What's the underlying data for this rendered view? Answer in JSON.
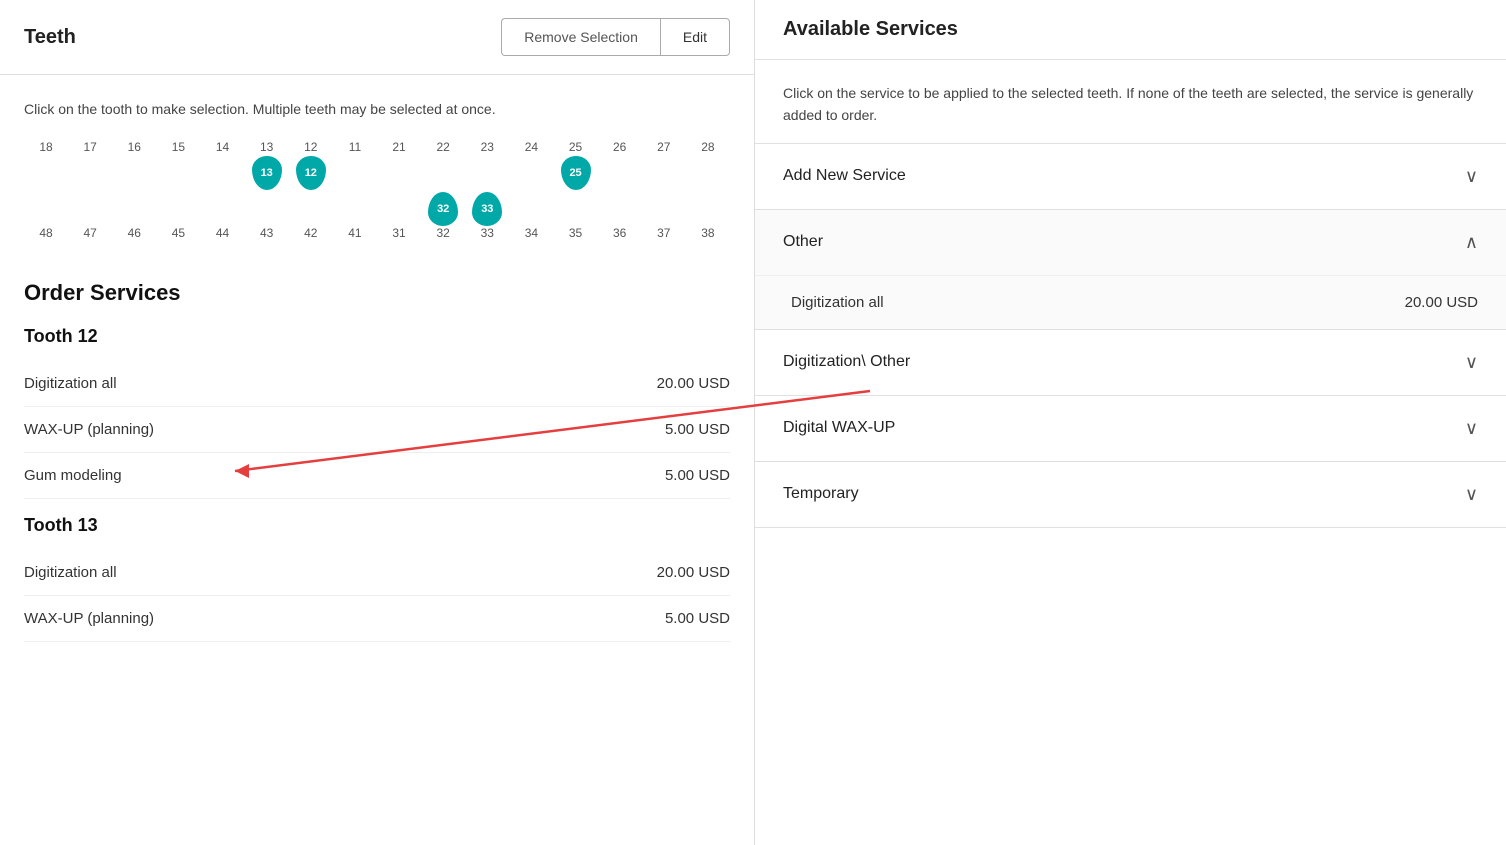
{
  "left": {
    "title": "Teeth",
    "remove_btn": "Remove Selection",
    "edit_btn": "Edit",
    "instruction": "Click on the tooth to make selection. Multiple teeth may be selected at once.",
    "teeth_top": [
      {
        "number": "18",
        "selected": false
      },
      {
        "number": "17",
        "selected": false
      },
      {
        "number": "16",
        "selected": false
      },
      {
        "number": "15",
        "selected": false
      },
      {
        "number": "14",
        "selected": false
      },
      {
        "number": "13",
        "selected": true
      },
      {
        "number": "12",
        "selected": true
      },
      {
        "number": "11",
        "selected": false
      },
      {
        "number": "21",
        "selected": false
      },
      {
        "number": "22",
        "selected": false
      },
      {
        "number": "23",
        "selected": false
      },
      {
        "number": "24",
        "selected": false
      },
      {
        "number": "25",
        "selected": true
      },
      {
        "number": "26",
        "selected": false
      },
      {
        "number": "27",
        "selected": false
      },
      {
        "number": "28",
        "selected": false
      }
    ],
    "teeth_bottom": [
      {
        "number": "48",
        "selected": false
      },
      {
        "number": "47",
        "selected": false
      },
      {
        "number": "46",
        "selected": false
      },
      {
        "number": "45",
        "selected": false
      },
      {
        "number": "44",
        "selected": false
      },
      {
        "number": "43",
        "selected": false
      },
      {
        "number": "42",
        "selected": false
      },
      {
        "number": "41",
        "selected": false
      },
      {
        "number": "31",
        "selected": false
      },
      {
        "number": "32",
        "selected": true
      },
      {
        "number": "33",
        "selected": true
      },
      {
        "number": "34",
        "selected": false
      },
      {
        "number": "35",
        "selected": false
      },
      {
        "number": "36",
        "selected": false
      },
      {
        "number": "37",
        "selected": false
      },
      {
        "number": "38",
        "selected": false
      }
    ],
    "order_services_title": "Order Services",
    "tooth_sections": [
      {
        "tooth_label": "Tooth 12",
        "services": [
          {
            "name": "Digitization all",
            "price": "20.00 USD"
          },
          {
            "name": "WAX-UP (planning)",
            "price": "5.00 USD"
          },
          {
            "name": "Gum modeling",
            "price": "5.00 USD"
          }
        ]
      },
      {
        "tooth_label": "Tooth 13",
        "services": [
          {
            "name": "Digitization all",
            "price": "20.00 USD"
          },
          {
            "name": "WAX-UP (planning)",
            "price": "5.00 USD"
          }
        ]
      }
    ]
  },
  "right": {
    "title": "Available Services",
    "instruction": "Click on the service to be applied to the selected teeth. If none of the teeth are selected, the service is generally added to order.",
    "categories": [
      {
        "name": "Add New Service",
        "expanded": false,
        "chevron": "∨",
        "items": []
      },
      {
        "name": "Other",
        "expanded": true,
        "chevron": "∧",
        "items": [
          {
            "name": "Digitization all",
            "price": "20.00 USD"
          }
        ]
      },
      {
        "name": "Digitization\\ Other",
        "expanded": false,
        "chevron": "∨",
        "items": []
      },
      {
        "name": "Digital WAX-UP",
        "expanded": false,
        "chevron": "∨",
        "items": []
      },
      {
        "name": "Temporary",
        "expanded": false,
        "chevron": "∨",
        "items": []
      }
    ]
  }
}
